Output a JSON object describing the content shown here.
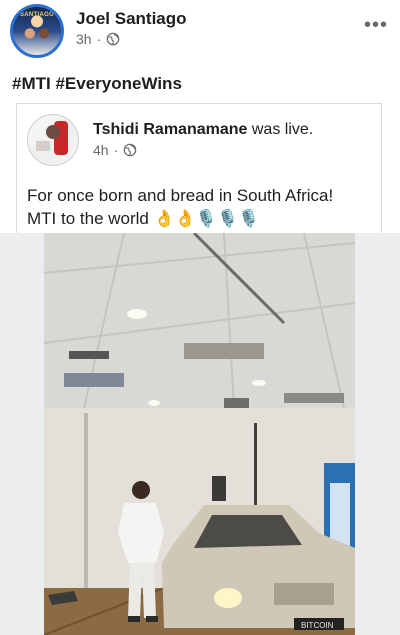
{
  "post": {
    "author": "Joel Santiago",
    "time": "3h",
    "separator": "·",
    "more_label": "•••",
    "avatar_text": "SANTIAGO",
    "hashtags": "#MTI #EveryoneWins"
  },
  "shared": {
    "author": "Tshidi Ramanamane",
    "action": "was live.",
    "time": "4h",
    "separator": "·",
    "text_line1": "For once born and bread in South Africa!",
    "text_line2": "MTI to the world 👌👌🎙️🎙️🎙️"
  },
  "video": {
    "sign_text": "BITCOIN"
  },
  "icons": {
    "post_audience": "globe-icon",
    "shared_audience": "globe-icon",
    "more": "more-options-icon"
  }
}
